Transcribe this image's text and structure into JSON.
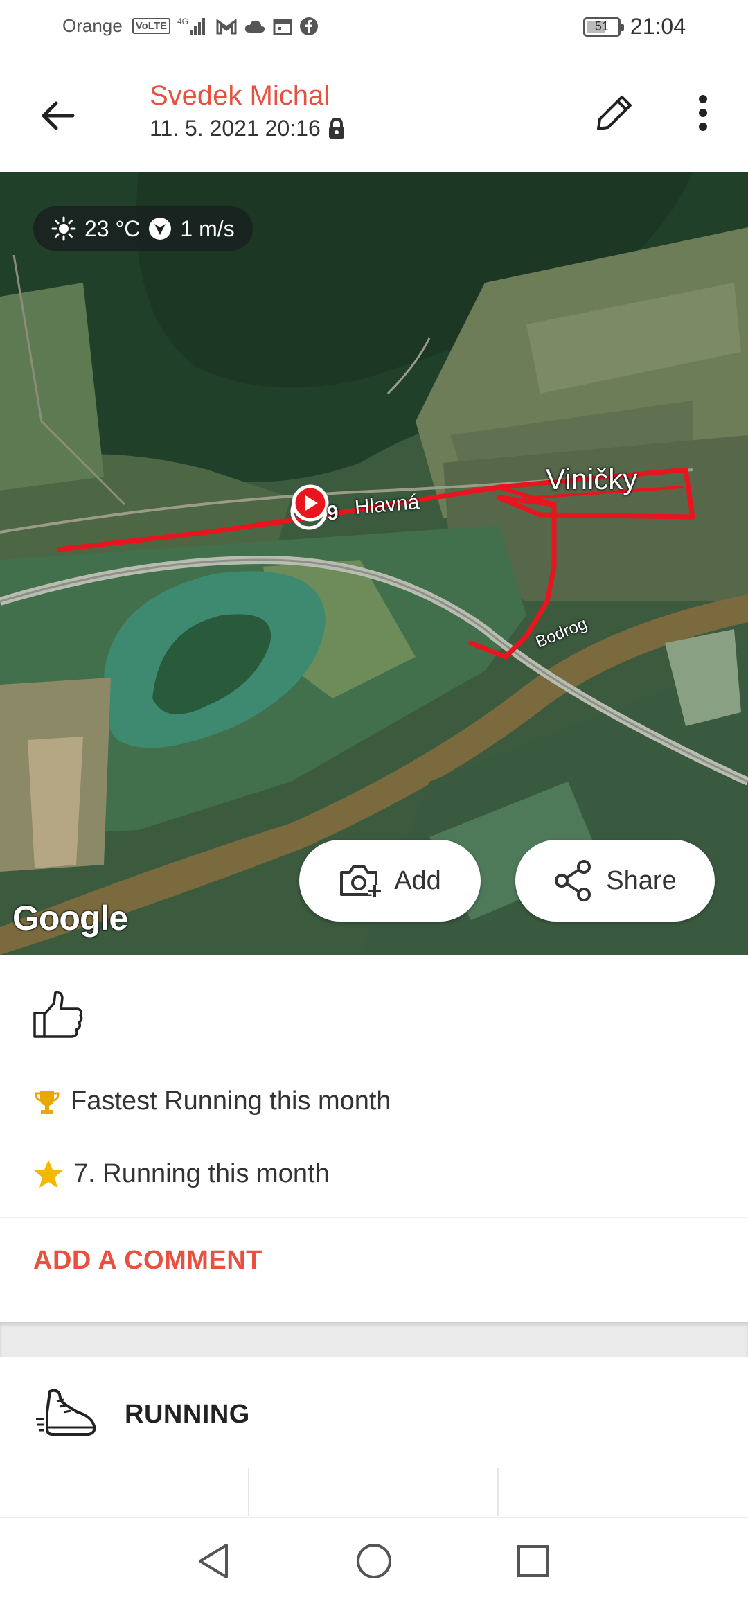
{
  "status_bar": {
    "carrier": "Orange",
    "volte_label": "VoLTE",
    "network": "4G",
    "battery": "51",
    "time": "21:04",
    "icons": [
      "volte-icon",
      "signal-icon",
      "gmail-icon",
      "cloud-icon",
      "calendar-icon",
      "facebook-icon"
    ]
  },
  "header": {
    "user_name": "Svedek Michal",
    "date": "11. 5. 2021 20:16",
    "icons": [
      "back-arrow-icon",
      "lock-icon",
      "pencil-icon",
      "more-vert-icon"
    ]
  },
  "map": {
    "weather": {
      "temperature": "23 °C",
      "wind": "1 m/s",
      "icons": [
        "sun-icon",
        "wind-direction-icon"
      ]
    },
    "labels": {
      "village": "Viničky",
      "street": "Hlavná",
      "street_number": "9",
      "river": "Bodrog"
    },
    "route_color": "#e8151f",
    "add_label": "Add",
    "share_label": "Share",
    "google_label": "Google"
  },
  "activity": {
    "achievements": [
      {
        "icon": "trophy-icon",
        "text": "Fastest Running this month",
        "color": "#e8a800"
      },
      {
        "icon": "star-icon",
        "text": "7. Running this month",
        "color": "#f5b800"
      }
    ],
    "add_comment": "ADD A COMMENT",
    "sport_label": "RUNNING"
  },
  "colors": {
    "accent": "#e8503f"
  },
  "nav": {
    "icons": [
      "nav-back-icon",
      "nav-home-icon",
      "nav-recents-icon"
    ]
  }
}
